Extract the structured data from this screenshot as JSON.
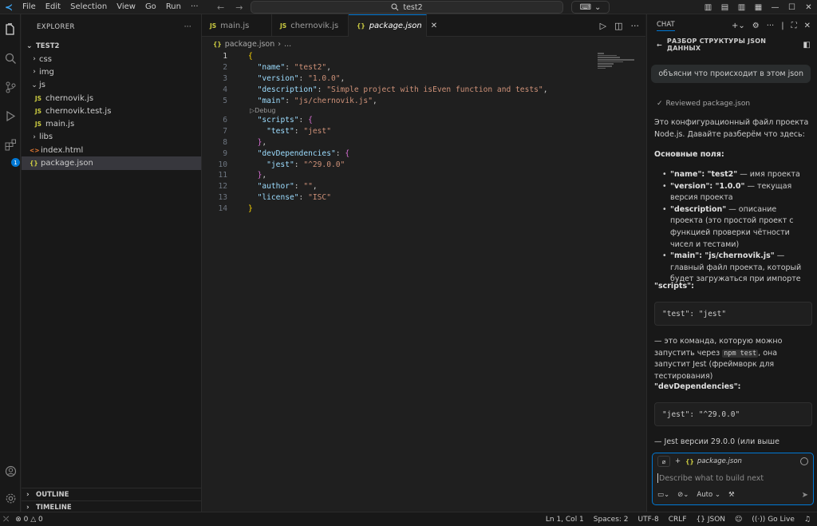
{
  "titlebar": {
    "menu": [
      "File",
      "Edit",
      "Selection",
      "View",
      "Go",
      "Run"
    ],
    "menu_more": "···",
    "search_text": "test2"
  },
  "explorer": {
    "header": "EXPLORER",
    "root": "TEST2",
    "items": [
      {
        "label": "css",
        "type": "folder",
        "depth": 1,
        "open": false
      },
      {
        "label": "img",
        "type": "folder",
        "depth": 1,
        "open": false
      },
      {
        "label": "js",
        "type": "folder",
        "depth": 1,
        "open": true
      },
      {
        "label": "chernovik.js",
        "type": "js",
        "depth": 2
      },
      {
        "label": "chernovik.test.js",
        "type": "js",
        "depth": 2
      },
      {
        "label": "main.js",
        "type": "js",
        "depth": 2
      },
      {
        "label": "libs",
        "type": "folder",
        "depth": 1,
        "open": false
      },
      {
        "label": "index.html",
        "type": "html",
        "depth": 1
      },
      {
        "label": "package.json",
        "type": "json",
        "depth": 1,
        "selected": true
      }
    ],
    "outline": "OUTLINE",
    "timeline": "TIMELINE",
    "extensions_badge": "1"
  },
  "editor": {
    "tabs": [
      {
        "label": "main.js",
        "icon": "JS"
      },
      {
        "label": "chernovik.js",
        "icon": "JS"
      },
      {
        "label": "package.json",
        "icon": "{}",
        "active": true
      }
    ],
    "breadcrumb": [
      "package.json",
      "..."
    ],
    "debug_lens": "Debug",
    "lines": [
      "{",
      "  \"name\": \"test2\",",
      "  \"version\": \"1.0.0\",",
      "  \"description\": \"Simple project with isEven function and tests\",",
      "  \"main\": \"js/chernovik.js\",",
      "  \"scripts\": {",
      "    \"test\": \"jest\"",
      "  },",
      "  \"devDependencies\": {",
      "    \"jest\": \"^29.0.0\"",
      "  },",
      "  \"author\": \"\",",
      "  \"license\": \"ISC\"",
      "}"
    ]
  },
  "chat": {
    "tab_label": "CHAT",
    "session_title": "РАЗБОР СТРУКТУРЫ JSON ДАННЫХ",
    "user_message": "объясни что происходит в этом json",
    "reviewed": "Reviewed package.json",
    "intro": "Это конфигурационный файл проекта Node.js. Давайте разберём что здесь:",
    "main_fields_heading": "Основные поля:",
    "fields": [
      {
        "key": "\"name\": \"test2\"",
        "desc": " — имя проекта"
      },
      {
        "key": "\"version\": \"1.0.0\"",
        "desc": " — текущая версия проекта"
      },
      {
        "key": "\"description\"",
        "desc": " — описание проекта (это простой проект с функцией проверки чётности чисел и тестами)"
      },
      {
        "key": "\"main\": \"js/chernovik.js\"",
        "desc": " — главный файл проекта, который будет загружаться при импорте"
      }
    ],
    "scripts_heading": "\"scripts\":",
    "scripts_code": "\"test\": \"jest\"",
    "scripts_expl_1": "— это команда, которую можно запустить через ",
    "scripts_expl_code": "npm test",
    "scripts_expl_2": ", она запустит Jest (фреймворк для тестирования)",
    "devdeps_heading": "\"devDependencies\":",
    "devdeps_code": "\"jest\": \"^29.0.0\"",
    "devdeps_expl": "— Jest версии 29.0.0 (или выше",
    "input": {
      "context_file": "package.json",
      "placeholder": "Describe what to build next",
      "mode": "Auto"
    }
  },
  "statusbar": {
    "errors": "0",
    "warnings": "0",
    "position": "Ln 1, Col 1",
    "spaces": "Spaces: 2",
    "encoding": "UTF-8",
    "eol": "CRLF",
    "language": "JSON",
    "golive": "Go Live"
  }
}
